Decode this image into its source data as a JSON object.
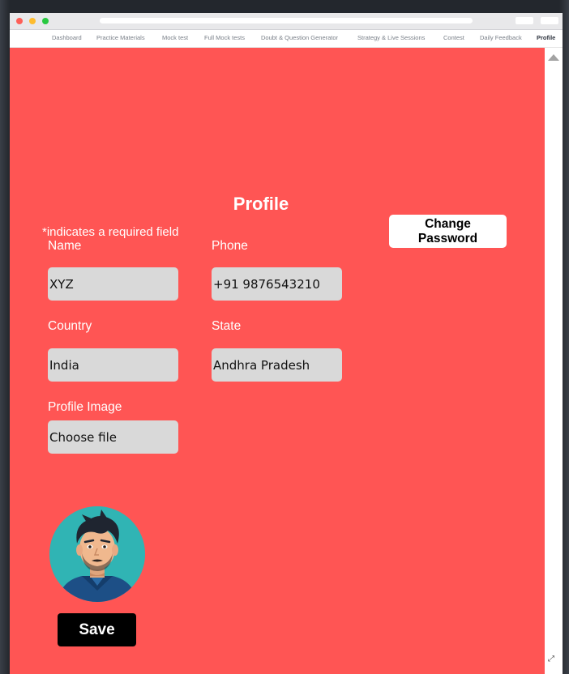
{
  "nav": {
    "items": [
      {
        "label": "Dashboard"
      },
      {
        "label": "Practice Materials"
      },
      {
        "label": "Mock test"
      },
      {
        "label": "Full Mock tests"
      },
      {
        "label": "Doubt & Question Generator"
      },
      {
        "label": "Strategy & Live Sessions"
      },
      {
        "label": "Contest"
      },
      {
        "label": "Daily Feedback"
      },
      {
        "label": "Profile",
        "active": true
      }
    ]
  },
  "profile": {
    "title": "Profile",
    "required_note": "*indicates a required field",
    "change_password_label": "Change Password",
    "fields": {
      "name": {
        "label": "Name",
        "value": "XYZ"
      },
      "phone": {
        "label": "Phone",
        "value": "+91 9876543210"
      },
      "country": {
        "label": "Country",
        "value": "India"
      },
      "state": {
        "label": "State",
        "value": "Andhra Pradesh"
      },
      "profile_image": {
        "label": "Profile Image",
        "button": "Choose file"
      }
    },
    "avatar_icon": "person-avatar",
    "save_label": "Save"
  },
  "colors": {
    "page_bg": "#ff5554",
    "input_bg": "#d9d9d9",
    "save_bg": "#000000",
    "change_pw_bg": "#ffffff"
  }
}
